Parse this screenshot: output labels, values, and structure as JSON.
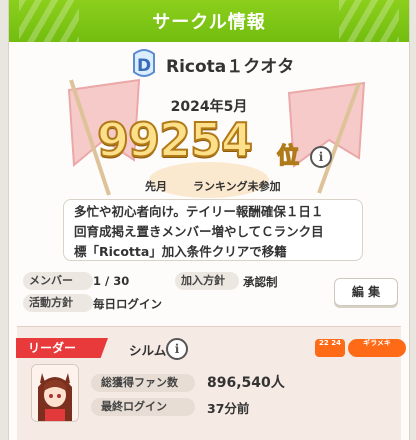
{
  "header": {
    "title": "サークル情報"
  },
  "circle": {
    "name": "Ricota１クオタ",
    "rank_letter": "D"
  },
  "ranking": {
    "month": "2024年5月",
    "rank": "99254",
    "rank_unit": "位",
    "prev_label": "先月",
    "prev_value": "ランキング未参加"
  },
  "description": {
    "lines": [
      "多忙や初心者向け。テイリー報酬確保１日１",
      "回育成掲え置きメンバー増やしてＣランク目",
      "標「Ricotta」加入条件クリアで移籍"
    ]
  },
  "details": {
    "member_label": "メンバー",
    "member_value": "1 / 30",
    "join_label": "加入方針",
    "join_value": "承認制",
    "activity_label": "活動方針",
    "activity_value": "毎日ログイン",
    "edit_label": "編 集"
  },
  "leader": {
    "tag": "リーダー",
    "name": "シルム",
    "badge_1": "22 24",
    "badge_2": "ギラメキ",
    "fans_label": "総獲得ファン数",
    "fans_value": "896,540人",
    "login_label": "最終ログイン",
    "login_value": "37分前"
  },
  "colors": {
    "header_green": "#7cc514",
    "leader_red": "#e83a3a",
    "badge_orange": "#ff6a17",
    "rank_gold": "#ffe08a"
  }
}
